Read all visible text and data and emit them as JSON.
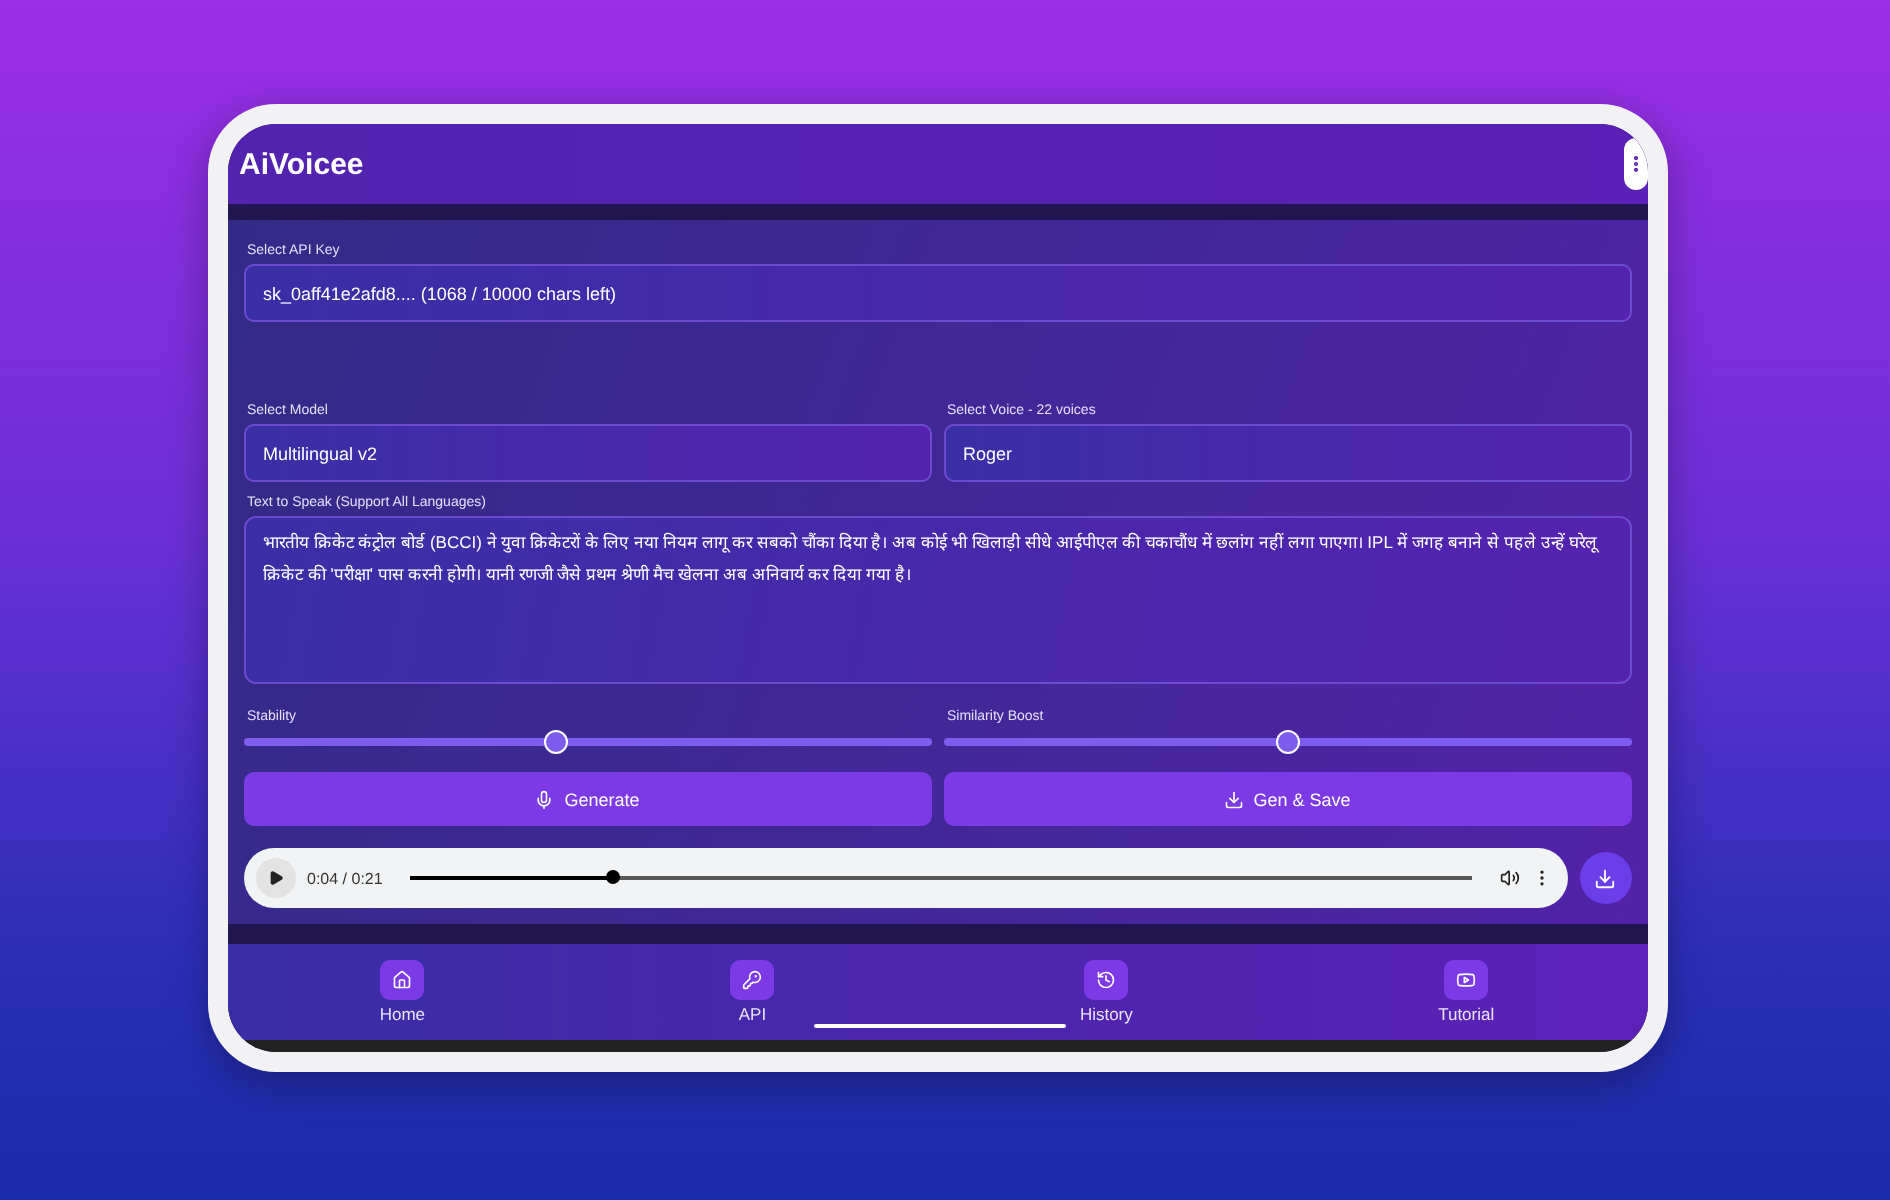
{
  "app_bar": {
    "title": "AiVoicee"
  },
  "api_key": {
    "label": "Select API Key",
    "value": "sk_0aff41e2afd8.... (1068 / 10000 chars left)"
  },
  "model": {
    "label": "Select Model",
    "value": "Multilingual v2"
  },
  "voice": {
    "label": "Select Voice - 22 voices",
    "value": "Roger"
  },
  "text_input": {
    "label": "Text to Speak (Support All Languages)",
    "value": "भारतीय क्रिकेट कंट्रोल बोर्ड (BCCI) ने युवा क्रिकेटरों के लिए नया नियम लागू कर सबको चौंका दिया है। अब कोई भी खिलाड़ी सीधे आईपीएल की चकाचौंध में छलांग नहीं लगा पाएगा। IPL में जगह बनाने से पहले उन्हें घरेलू क्रिकेट की 'परीक्षा' पास करनी होगी। यानी रणजी जैसे प्रथम श्रेणी मैच खेलना अब अनिवार्य कर दिया गया है।"
  },
  "sliders": [
    {
      "label": "Stability",
      "level": 0.455
    },
    {
      "label": "Similarity Boost",
      "level": 0.5
    }
  ],
  "buttons": [
    {
      "label": "Generate",
      "kind": "mic"
    },
    {
      "label": "Gen & Save",
      "kind": "download"
    }
  ],
  "player": {
    "time": "0:04 / 0:21",
    "level": 0.19
  },
  "nav": [
    {
      "label": "Home",
      "kind": "home"
    },
    {
      "label": "API",
      "kind": "key"
    },
    {
      "label": "History",
      "kind": "history"
    },
    {
      "label": "Tutorial",
      "kind": "video"
    }
  ]
}
